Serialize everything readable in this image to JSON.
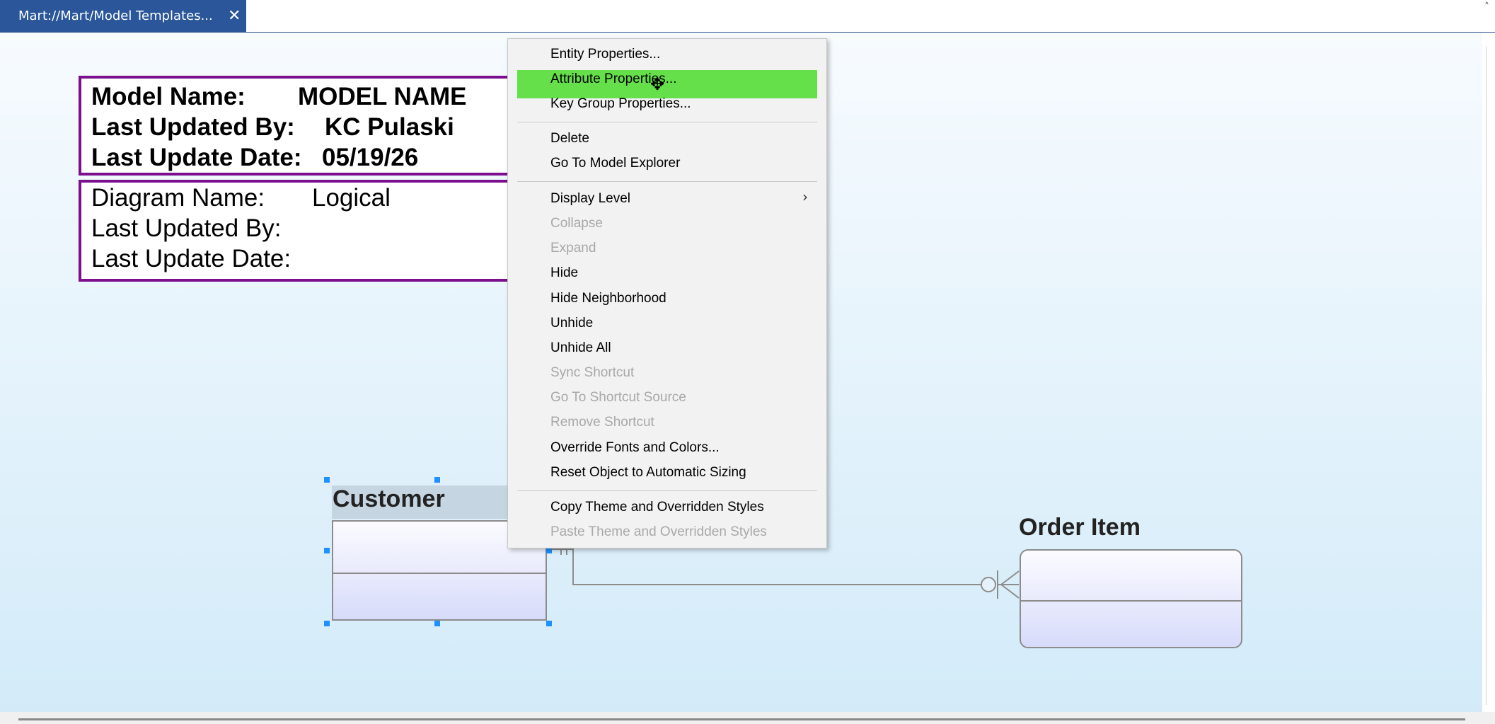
{
  "tab": {
    "title": "Mart://Mart/Model Templates...",
    "close": "✕"
  },
  "model_block": {
    "model_name_label": "Model Name:",
    "model_name_value": "MODEL NAME",
    "updated_by_label": "Last Updated By:",
    "updated_by_value": "KC Pulaski",
    "update_date_label": "Last Update Date:",
    "update_date_value": "05/19/26"
  },
  "diagram_block": {
    "diagram_name_label": "Diagram Name:",
    "diagram_name_value": "Logical",
    "updated_by_label": "Last Updated By:",
    "update_date_label": "Last Update Date:"
  },
  "entities": {
    "customer": "Customer",
    "order_item": "Order Item"
  },
  "context_menu": {
    "items": [
      {
        "label": "Entity Properties...",
        "enabled": true
      },
      {
        "label": "Attribute Properties...",
        "enabled": true,
        "highlighted": true
      },
      {
        "label": "Key Group Properties...",
        "enabled": true
      },
      {
        "label": "Delete",
        "enabled": true
      },
      {
        "label": "Go To Model Explorer",
        "enabled": true
      },
      {
        "label": "Display Level",
        "enabled": true,
        "submenu": true
      },
      {
        "label": "Collapse",
        "enabled": false
      },
      {
        "label": "Expand",
        "enabled": false
      },
      {
        "label": "Hide",
        "enabled": true
      },
      {
        "label": "Hide Neighborhood",
        "enabled": true
      },
      {
        "label": "Unhide",
        "enabled": true
      },
      {
        "label": "Unhide All",
        "enabled": true
      },
      {
        "label": "Sync Shortcut",
        "enabled": false
      },
      {
        "label": "Go To Shortcut Source",
        "enabled": false
      },
      {
        "label": "Remove Shortcut",
        "enabled": false
      },
      {
        "label": "Override Fonts and Colors...",
        "enabled": true
      },
      {
        "label": "Reset Object to Automatic Sizing",
        "enabled": true
      },
      {
        "label": "Copy Theme and Overridden Styles",
        "enabled": true
      },
      {
        "label": "Paste Theme and Overridden Styles",
        "enabled": false
      }
    ],
    "submenu_arrow": "›"
  },
  "icons": {
    "close": "close-icon",
    "submenu": "chevron-right-icon",
    "cursor": "move-cursor-icon"
  },
  "colors": {
    "tab_bg": "#2b579a",
    "title_block_border": "#7b0f8c",
    "menu_highlight": "#66e04a",
    "selection_handle": "#1e90ff"
  }
}
